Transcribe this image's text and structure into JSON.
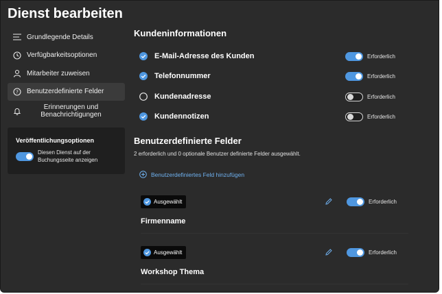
{
  "page": {
    "title": "Dienst bearbeiten"
  },
  "sidebar": {
    "items": [
      {
        "label": "Grundlegende Details",
        "icon": "list-icon"
      },
      {
        "label": "Verfügbarkeitsoptionen",
        "icon": "clock-icon"
      },
      {
        "label": "Mitarbeiter zuweisen",
        "icon": "person-icon"
      },
      {
        "label": "Benutzerdefinierte Felder",
        "icon": "question-circle-icon",
        "active": true
      },
      {
        "label": "Erinnerungen und Benachrichtigungen",
        "icon": "bell-icon"
      }
    ],
    "publish": {
      "title": "Veröffentlichungsoptionen",
      "toggle_label": "Diesen Dienst auf der Buchungsseite anzeigen",
      "toggle_on": true
    }
  },
  "customer_info": {
    "title": "Kundeninformationen",
    "rows": [
      {
        "label": "E-Mail-Adresse des Kunden",
        "checked": true,
        "required_label": "Erforderlich",
        "required_on": true
      },
      {
        "label": "Telefonnummer",
        "checked": true,
        "required_label": "Erforderlich",
        "required_on": true
      },
      {
        "label": "Kundenadresse",
        "checked": false,
        "required_label": "Erforderlich",
        "required_on": false
      },
      {
        "label": "Kundennotizen",
        "checked": true,
        "required_label": "Erforderlich",
        "required_on": false
      }
    ]
  },
  "custom_fields": {
    "title": "Benutzerdefinierte Felder",
    "summary": "2 erforderlich und 0 optionale Benutzer definierte Felder ausgewählt.",
    "add_label": "Benutzerdefiniertes Feld hinzufügen",
    "cards": [
      {
        "badge": "Ausgewählt",
        "name": "Firmenname",
        "required_label": "Erforderlich",
        "required_on": true
      },
      {
        "badge": "Ausgewählt",
        "name": "Workshop Thema",
        "required_label": "Erforderlich",
        "required_on": true
      }
    ]
  },
  "colors": {
    "accent": "#4f97e0",
    "background": "#2b2b2b",
    "panel": "#1f1f1f",
    "link": "#6fb1f0"
  }
}
